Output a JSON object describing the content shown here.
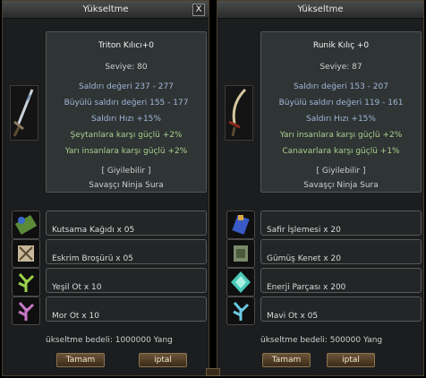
{
  "windows": [
    {
      "title": "Yükseltme",
      "close_label": "X",
      "item": {
        "name": "Triton Kılıcı+0",
        "level": "Seviye: 80",
        "stats": [
          "Saldırı değeri 237 - 277",
          "Büyülü saldırı değeri 155 - 177",
          "Saldırı Hızı +15%"
        ],
        "bonuses": [
          "Şeytanlara karşı güçlü +2%",
          "Yarı insanlara karşı güçlü +2%"
        ],
        "wearable": "[ Giyilebilir ]",
        "classes": "Savaşçı Ninja Sura"
      },
      "materials": [
        {
          "label": "Kutsama Kağıdı x 05",
          "icon": "blessing-scroll-icon"
        },
        {
          "label": "Eskrim Broşürü x 05",
          "icon": "fencing-brochure-icon"
        },
        {
          "label": "Yeşil Ot x 10",
          "icon": "green-herb-icon"
        },
        {
          "label": "Mor Ot x 10",
          "icon": "purple-herb-icon"
        }
      ],
      "cost": "ükseltme bedeli: 1000000 Yang",
      "ok_label": "Tamam",
      "cancel_label": "iptal"
    },
    {
      "title": "Yükseltme",
      "item": {
        "name": "Runik Kılıç +0",
        "level": "Seviye: 87",
        "stats": [
          "Saldırı değeri 153 - 207",
          "Büyülü saldırı değeri 119 - 161",
          "Saldırı Hızı +15%"
        ],
        "bonuses": [
          "Yarı insanlara karşı güçlü +2%",
          "Canavarlara karşı güçlü +1%"
        ],
        "wearable": "[ Giyilebilir ]",
        "classes": "Savaşçı Ninja Sura"
      },
      "materials": [
        {
          "label": "Safir İşlemesi x 20",
          "icon": "sapphire-craft-icon"
        },
        {
          "label": "Gümüş Kenet x 20",
          "icon": "silver-clasp-icon"
        },
        {
          "label": "Enerji Parçası x 200",
          "icon": "energy-fragment-icon"
        },
        {
          "label": "Mavi Ot x 05",
          "icon": "blue-herb-icon"
        }
      ],
      "cost": "ükseltme bedeli: 500000 Yang",
      "ok_label": "Tamam",
      "cancel_label": "iptal"
    }
  ]
}
